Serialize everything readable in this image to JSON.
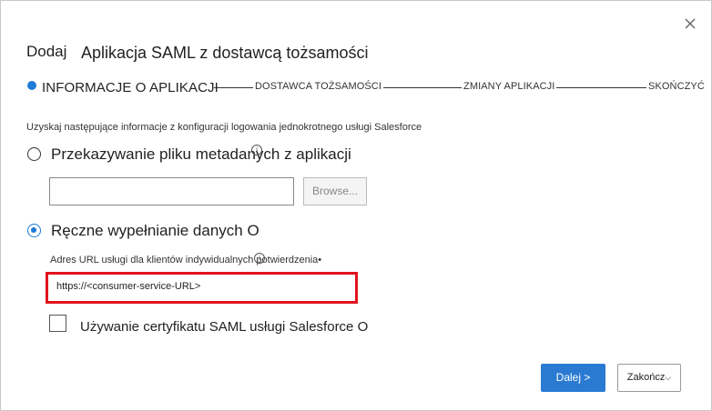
{
  "dialog": {
    "title_prefix": "Dodaj",
    "title": "Aplikacja SAML z dostawcą tożsamości",
    "close_icon": "close-icon"
  },
  "steps": [
    {
      "label": "INFORMACJE O APLIKACJI",
      "active": true
    },
    {
      "label": "DOSTAWCA TOŻSAMOŚCI",
      "active": false
    },
    {
      "label": "ZMIANY APLIKACJI",
      "active": false
    },
    {
      "label": "SKOŃCZYĆ",
      "active": false
    }
  ],
  "form": {
    "hint": "Uzyskaj następujące informacje z konfiguracji logowania jednokrotnego usługi Salesforce",
    "option_metadata": {
      "label": "Przekazywanie pliku metadanych z aplikacji",
      "selected": false
    },
    "file_value": "",
    "browse_label": "Browse...",
    "option_manual": {
      "label": "Ręczne wypełnianie danych O",
      "selected": true
    },
    "url_label": "Adres URL usługi dla klientów indywidualnych potwierdzenia•",
    "url_value": "https://<consumer-service-URL>",
    "cert_label": "Używanie certyfikatu SAML usługi Salesforce O",
    "cert_checked": false
  },
  "footer": {
    "next_label": "Dalej >",
    "finish_label": "Zakończ"
  },
  "colors": {
    "accent": "#2a7ad2",
    "highlight": "#e0141e"
  }
}
